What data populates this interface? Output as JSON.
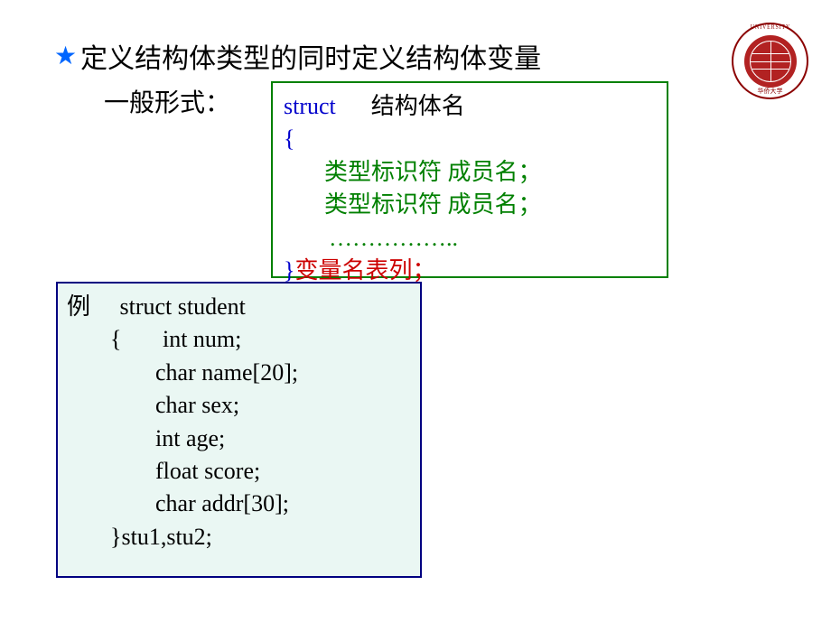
{
  "title": "定义结构体类型的同时定义结构体变量",
  "subtitle": "一般形式：",
  "syntax": {
    "struct_keyword": "struct",
    "struct_name": "结构体名",
    "open_brace": "{",
    "member_line1": "类型标识符    成员名；",
    "member_line2": "类型标识符    成员名；",
    "dots": "……………..",
    "close_brace": "}",
    "var_list": "变量名表列；"
  },
  "example": {
    "label": "例",
    "struct_decl": "struct   student",
    "open": "{",
    "field1": "int num;",
    "field2": "char  name[20];",
    "field3": "char sex;",
    "field4": "int age;",
    "field5": "float score;",
    "field6": "char addr[30];",
    "close_vars": "}stu1,stu2;"
  },
  "logo": {
    "top_text": "UNIVERSITY",
    "bottom_text": "华侨大学"
  }
}
